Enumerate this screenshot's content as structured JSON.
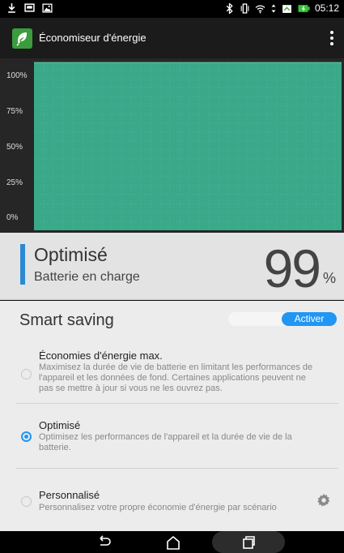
{
  "status_bar": {
    "icons_left": [
      "download-icon",
      "message-icon",
      "image-icon"
    ],
    "icons_right": [
      "bluetooth-icon",
      "vibrate-icon",
      "wifi-icon",
      "data-transfer-icon",
      "battery-saver-icon",
      "battery-charging-icon"
    ],
    "time": "05:12"
  },
  "app_bar": {
    "title": "Économiseur d'énergie",
    "logo_icon": "leaf-icon",
    "menu_icon": "overflow-menu-icon"
  },
  "chart": {
    "y_ticks": [
      "100%",
      "75%",
      "50%",
      "25%",
      "0%"
    ],
    "fill_color": "#3aa98a"
  },
  "chart_data": {
    "type": "area",
    "title": "",
    "xlabel": "",
    "ylabel": "",
    "y_tick_labels": [
      "100%",
      "75%",
      "50%",
      "25%",
      "0%"
    ],
    "ylim": [
      0,
      100
    ],
    "x": [
      0,
      1
    ],
    "values": [
      99,
      99
    ],
    "grid": true
  },
  "status_card": {
    "title": "Optimisé",
    "subtitle": "Batterie en charge",
    "battery_level": "99",
    "battery_unit": "%",
    "accent_color": "#2a8ad4"
  },
  "smart_saving": {
    "label": "Smart saving",
    "toggle_label": "Activer",
    "toggle_color": "#2196f3"
  },
  "options": [
    {
      "title": "Économies d'énergie max.",
      "description": "Maximisez la durée de vie de batterie en limitant les performances de l'appareil et les données de fond. Certaines applications peuvent ne pas se mettre à jour si vous ne les ouvrez pas.",
      "checked": false
    },
    {
      "title": "Optimisé",
      "description": "Optimisez les performances de l'appareil et la durée de vie de la batterie.",
      "checked": true
    },
    {
      "title": "Personnalisé",
      "description": "Personnalisez votre propre économie d'énergie par scénario",
      "checked": false,
      "icon": "gear-icon"
    }
  ],
  "nav_bar": {
    "buttons": [
      "back-icon",
      "home-icon",
      "recents-icon"
    ]
  }
}
